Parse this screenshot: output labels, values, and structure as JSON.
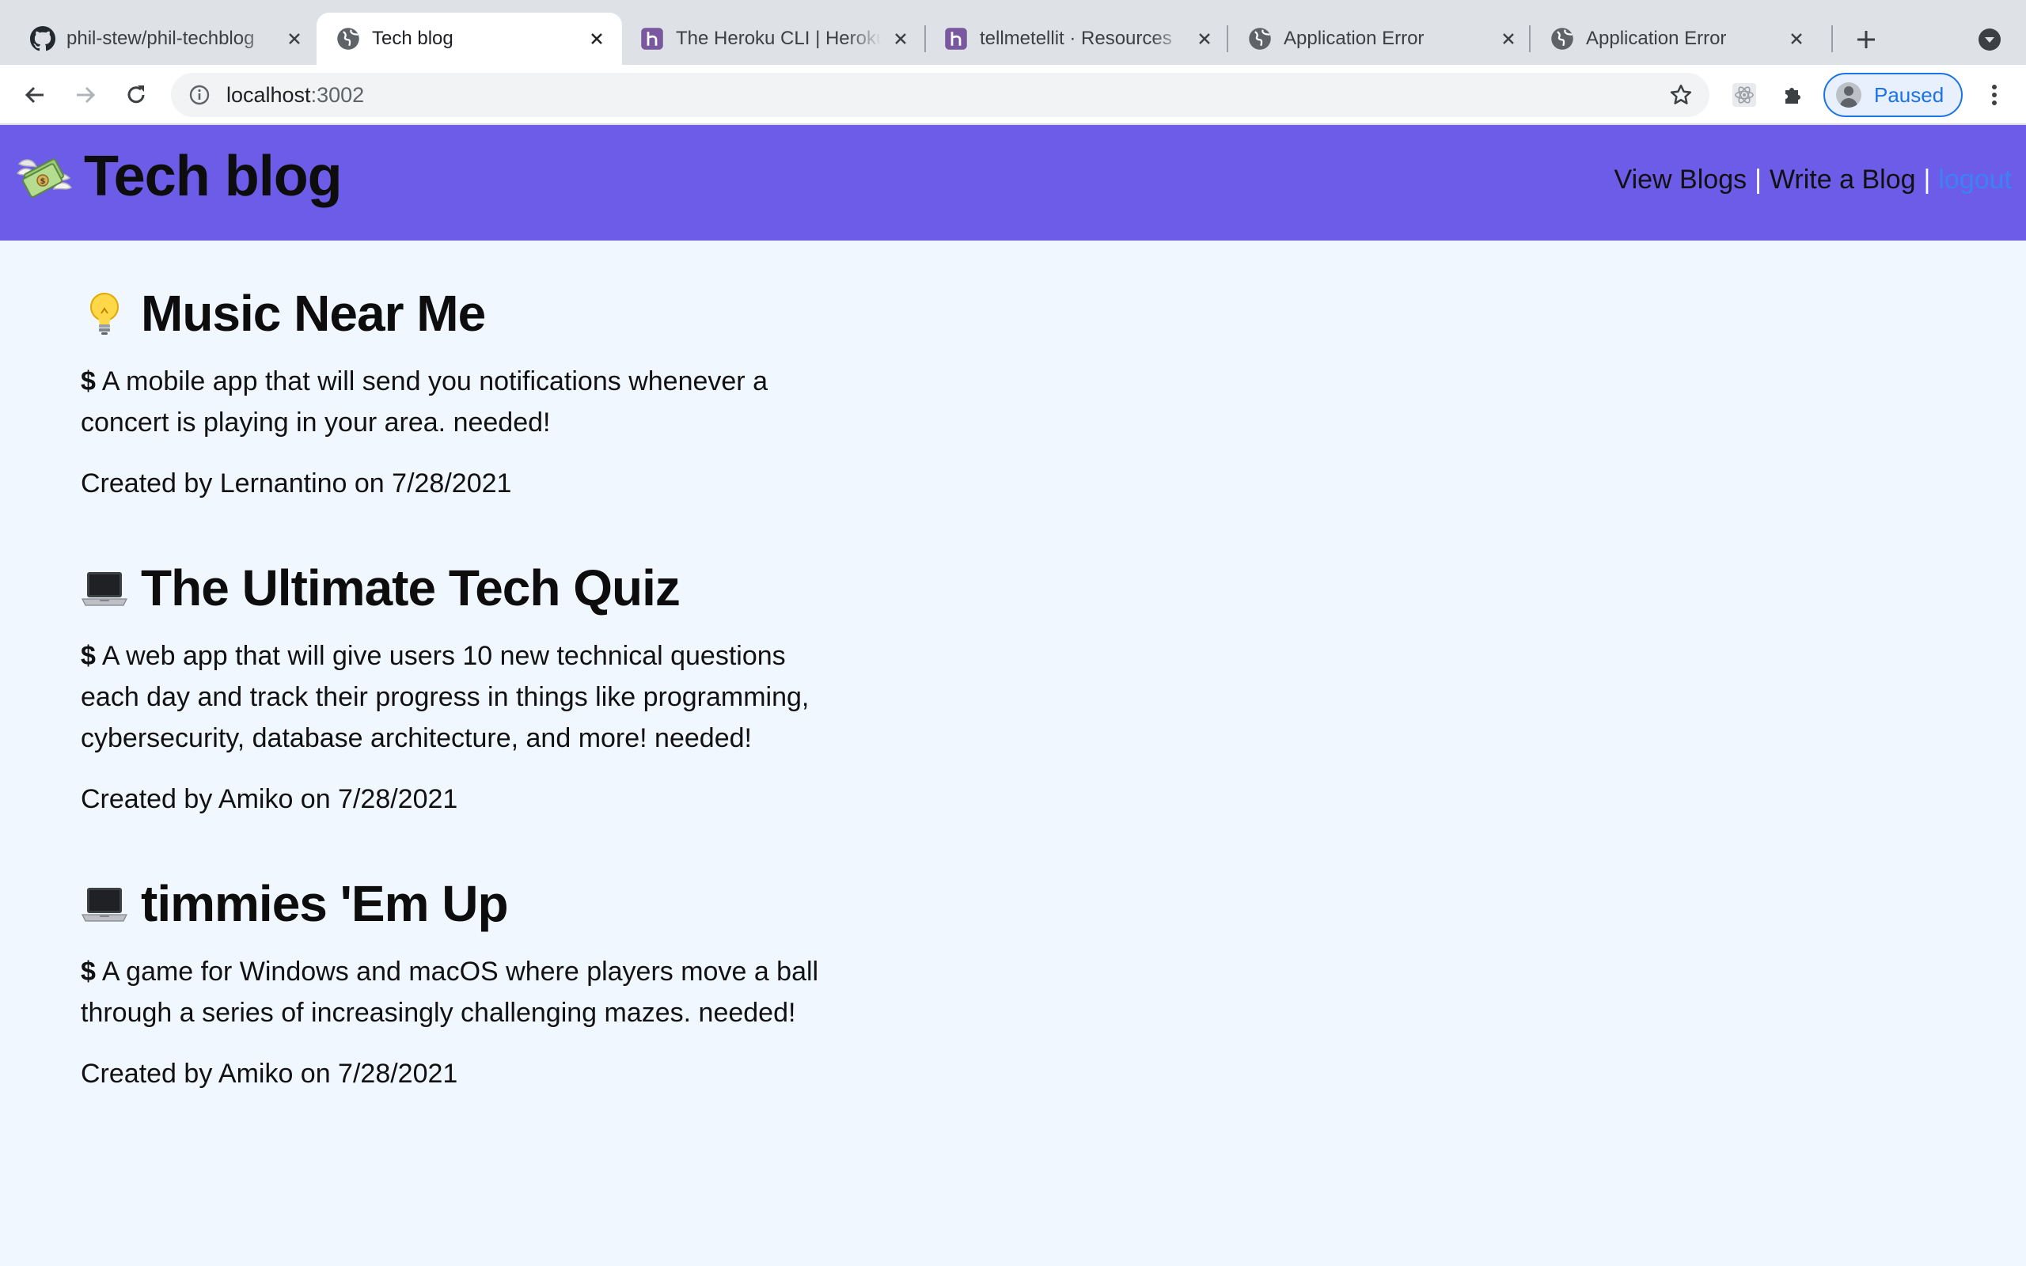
{
  "browser": {
    "tabs": [
      {
        "title": "phil-stew/phil-techblog",
        "icon": "github-icon",
        "active": false
      },
      {
        "title": "Tech blog",
        "icon": "globe-icon",
        "active": true
      },
      {
        "title": "The Heroku CLI | Heroku",
        "icon": "heroku-icon",
        "active": false
      },
      {
        "title": "tellmetellit · Resources",
        "icon": "heroku-icon",
        "active": false
      },
      {
        "title": "Application Error",
        "icon": "globe-icon",
        "active": false
      },
      {
        "title": "Application Error",
        "icon": "globe-icon",
        "active": false
      }
    ],
    "address": {
      "host": "localhost",
      "port": ":3002"
    },
    "profile_label": "Paused"
  },
  "site": {
    "title": "Tech blog",
    "logo_icon": "money-with-wings-icon",
    "nav": {
      "view_blogs": "View Blogs",
      "write_blog": "Write a Blog",
      "separator": "|",
      "logout": "logout"
    },
    "colors": {
      "header": "#6c5ce7",
      "background": "#f0f7ff",
      "logout_link": "#3b82f6"
    }
  },
  "posts": [
    {
      "icon": "light-bulb-icon",
      "title": "Music Near Me",
      "prefix": "$",
      "body": "A mobile app that will send you notifications whenever a concert is playing in your area. needed!",
      "meta": "Created by Lernantino on 7/28/2021"
    },
    {
      "icon": "laptop-icon",
      "title": "The Ultimate Tech Quiz",
      "prefix": "$",
      "body": "A web app that will give users 10 new technical questions each day and track their progress in things like programming, cybersecurity, database architecture, and more! needed!",
      "meta": "Created by Amiko on 7/28/2021"
    },
    {
      "icon": "laptop-icon",
      "title": "timmies 'Em Up",
      "prefix": "$",
      "body": "A game for Windows and macOS where players move a ball through a series of increasingly challenging mazes. needed!",
      "meta": "Created by Amiko on 7/28/2021"
    }
  ]
}
